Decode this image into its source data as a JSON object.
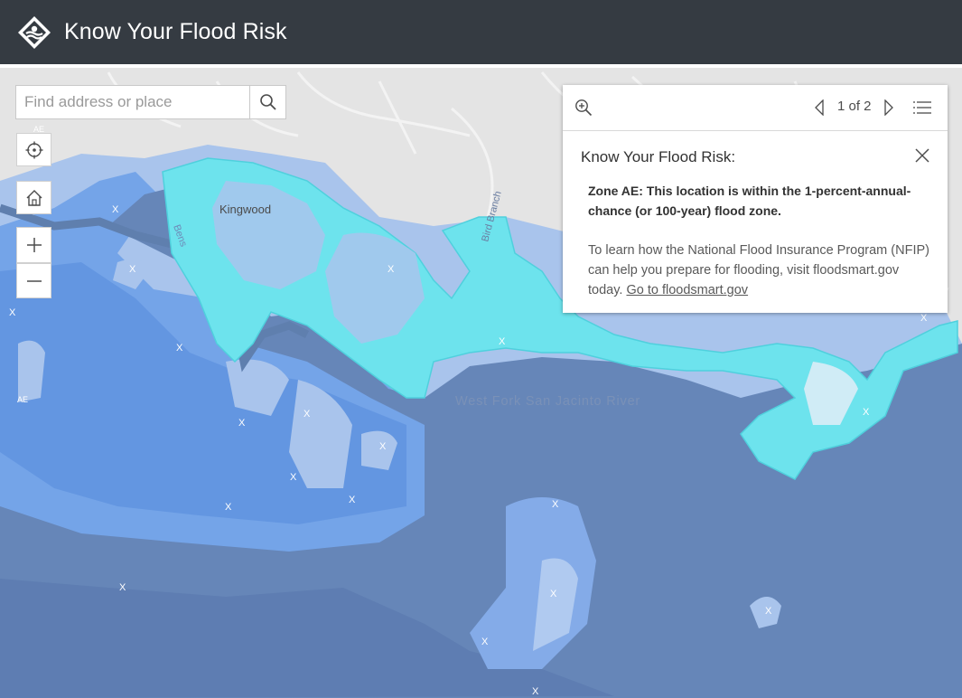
{
  "header": {
    "title": "Know Your Flood Risk",
    "logo_icon": "flood-logo-icon"
  },
  "search": {
    "placeholder": "Find address or place",
    "button_icon": "search-icon"
  },
  "map_controls": {
    "locate_icon": "locate-icon",
    "home_icon": "home-icon",
    "zoom_in_icon": "plus-icon",
    "zoom_out_icon": "minus-icon"
  },
  "map_labels": {
    "city": "Kingwood",
    "river": "West Fork San Jacinto River",
    "creek": "Bens",
    "branch": "Bird Branch",
    "zone_marker": "X",
    "zone_ae": "AE"
  },
  "popup": {
    "zoom_icon": "zoom-to-icon",
    "pager": "1 of 2",
    "title": "Know Your Flood Risk:",
    "zone_text": "Zone AE: This location is within the 1-percent-annual-chance (or 100-year) flood zone.",
    "description": "To learn how the National Flood Insurance Program (NFIP) can help you prepare for flooding, visit floodsmart.gov today.",
    "link_text": "Go to floodsmart.gov"
  },
  "colors": {
    "header_bg": "#353b42",
    "base_map": "#d9d9d9",
    "zone_x_shaded": "#6fa2e6",
    "zone_x_light": "#a6c2ea",
    "zone_ae": "#4b86d8",
    "floodway": "#6486b5",
    "selected_zone": "#6ee4ee"
  }
}
